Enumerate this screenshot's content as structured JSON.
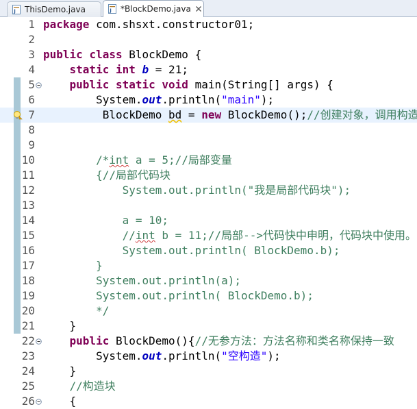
{
  "tabs": [
    {
      "label": "ThisDemo.java",
      "active": false,
      "icon": "java-file-icon"
    },
    {
      "label": "*BlockDemo.java",
      "active": true,
      "icon": "java-file-icon",
      "close_icon": "close-tab-icon"
    }
  ],
  "editor": {
    "current_line": 7,
    "colors": {
      "keyword": "#7f0055",
      "string": "#2a00ff",
      "comment": "#3f7f5f",
      "field": "#0000c0",
      "current_line_bg": "#e8f2fe",
      "change_bar": "#a9c8d6"
    },
    "lines": [
      {
        "n": "1",
        "parts": [
          [
            "kw",
            "package"
          ],
          [
            "pl",
            " com.shsxt.constructor01;"
          ]
        ]
      },
      {
        "n": "2",
        "parts": []
      },
      {
        "n": "3",
        "parts": [
          [
            "kw",
            "public"
          ],
          [
            "pl",
            " "
          ],
          [
            "kw",
            "class"
          ],
          [
            "pl",
            " BlockDemo {"
          ]
        ]
      },
      {
        "n": "4",
        "parts": [
          [
            "pl",
            "    "
          ],
          [
            "kw",
            "static"
          ],
          [
            "pl",
            " "
          ],
          [
            "kw",
            "int"
          ],
          [
            "pl",
            " "
          ],
          [
            "sfi",
            "b"
          ],
          [
            "pl",
            " = 21;"
          ]
        ]
      },
      {
        "n": "5",
        "parts": [
          [
            "pl",
            "    "
          ],
          [
            "kw",
            "public"
          ],
          [
            "pl",
            " "
          ],
          [
            "kw",
            "static"
          ],
          [
            "pl",
            " "
          ],
          [
            "kw",
            "void"
          ],
          [
            "pl",
            " main(String[] args) {"
          ]
        ]
      },
      {
        "n": "6",
        "parts": [
          [
            "pl",
            "        System."
          ],
          [
            "sf",
            "out"
          ],
          [
            "pl",
            ".println("
          ],
          [
            "str",
            "\"main\""
          ],
          [
            "pl",
            ");"
          ]
        ]
      },
      {
        "n": "7",
        "parts": [
          [
            "pl",
            "         BlockDemo "
          ],
          [
            "warn",
            "bd"
          ],
          [
            "pl",
            " = "
          ],
          [
            "kw",
            "new"
          ],
          [
            "pl",
            " BlockDemo();"
          ],
          [
            "cmt",
            "//创建对象，调用构造"
          ]
        ]
      },
      {
        "n": "8",
        "parts": []
      },
      {
        "n": "9",
        "parts": []
      },
      {
        "n": "10",
        "parts": [
          [
            "cmt",
            "        /*"
          ],
          [
            "cmtu",
            "int"
          ],
          [
            "cmt",
            " a = 5;//局部变量"
          ]
        ]
      },
      {
        "n": "11",
        "parts": [
          [
            "cmt",
            "        {//局部代码块"
          ]
        ]
      },
      {
        "n": "12",
        "parts": [
          [
            "cmt",
            "            System.out.println(\"我是局部代码块\");"
          ]
        ]
      },
      {
        "n": "13",
        "parts": []
      },
      {
        "n": "14",
        "parts": [
          [
            "cmt",
            "            a = 10;"
          ]
        ]
      },
      {
        "n": "15",
        "parts": [
          [
            "cmt",
            "            //"
          ],
          [
            "cmtu",
            "int"
          ],
          [
            "cmt",
            " b = 11;//局部-->代码快中申明，代码块中使用。"
          ]
        ]
      },
      {
        "n": "16",
        "parts": [
          [
            "cmt",
            "            System.out.println( BlockDemo.b);"
          ]
        ]
      },
      {
        "n": "17",
        "parts": [
          [
            "cmt",
            "        }"
          ]
        ]
      },
      {
        "n": "18",
        "parts": [
          [
            "cmt",
            "        System.out.println(a);"
          ]
        ]
      },
      {
        "n": "19",
        "parts": [
          [
            "cmt",
            "        System.out.println( BlockDemo.b);"
          ]
        ]
      },
      {
        "n": "20",
        "parts": [
          [
            "cmt",
            "        */"
          ]
        ]
      },
      {
        "n": "21",
        "parts": [
          [
            "pl",
            "    }"
          ]
        ]
      },
      {
        "n": "22",
        "parts": [
          [
            "pl",
            "    "
          ],
          [
            "kw",
            "public"
          ],
          [
            "pl",
            " BlockDemo(){"
          ],
          [
            "cmt",
            "//无参方法：方法名称和类名称保持一致"
          ]
        ]
      },
      {
        "n": "23",
        "parts": [
          [
            "pl",
            "        System."
          ],
          [
            "sf",
            "out"
          ],
          [
            "pl",
            ".println("
          ],
          [
            "str",
            "\"空构造\""
          ],
          [
            "pl",
            ");"
          ]
        ]
      },
      {
        "n": "24",
        "parts": [
          [
            "pl",
            "    }"
          ]
        ]
      },
      {
        "n": "25",
        "parts": [
          [
            "cmt",
            "    //构造块"
          ]
        ]
      },
      {
        "n": "26",
        "parts": [
          [
            "pl",
            "    {"
          ]
        ]
      }
    ]
  }
}
